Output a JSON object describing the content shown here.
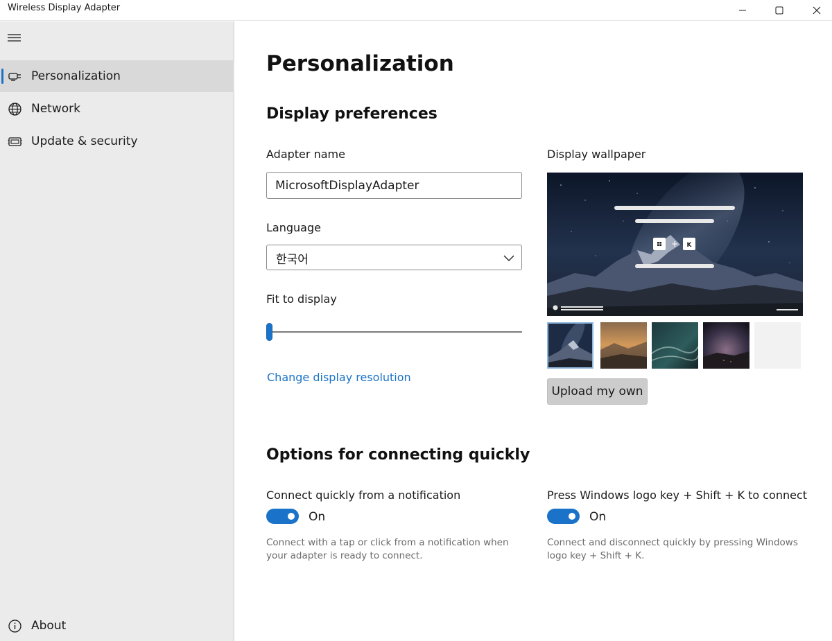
{
  "window": {
    "title": "Wireless Display Adapter"
  },
  "sidebar": {
    "items": [
      {
        "label": "Personalization",
        "icon": "personalization-icon",
        "selected": true
      },
      {
        "label": "Network",
        "icon": "globe-icon",
        "selected": false
      },
      {
        "label": "Update & security",
        "icon": "chip-icon",
        "selected": false
      }
    ],
    "about": {
      "label": "About",
      "icon": "info-icon"
    }
  },
  "main": {
    "page_title": "Personalization",
    "display_prefs": {
      "heading": "Display preferences",
      "adapter_name_label": "Adapter name",
      "adapter_name_value": "MicrosoftDisplayAdapter",
      "language_label": "Language",
      "language_value": "한국어",
      "fit_label": "Fit to display",
      "fit_value": 0,
      "change_resolution_link": "Change display resolution",
      "wallpaper_label": "Display wallpaper",
      "preview_keys": {
        "plus": "+",
        "k": "K"
      },
      "upload_label": "Upload my own"
    },
    "connect_options": {
      "heading": "Options for connecting quickly",
      "notification": {
        "label": "Connect quickly from a notification",
        "state": "On",
        "description": "Connect with a tap or click from a notification when your adapter is ready to connect."
      },
      "shortcut": {
        "label": "Press Windows logo key + Shift + K to connect",
        "state": "On",
        "description": "Connect and disconnect quickly by pressing Windows logo key + Shift + K."
      }
    }
  },
  "colors": {
    "accent": "#1a73c8",
    "sidebar_bg": "#ebebeb",
    "selected_bg": "#d9d9d9"
  }
}
